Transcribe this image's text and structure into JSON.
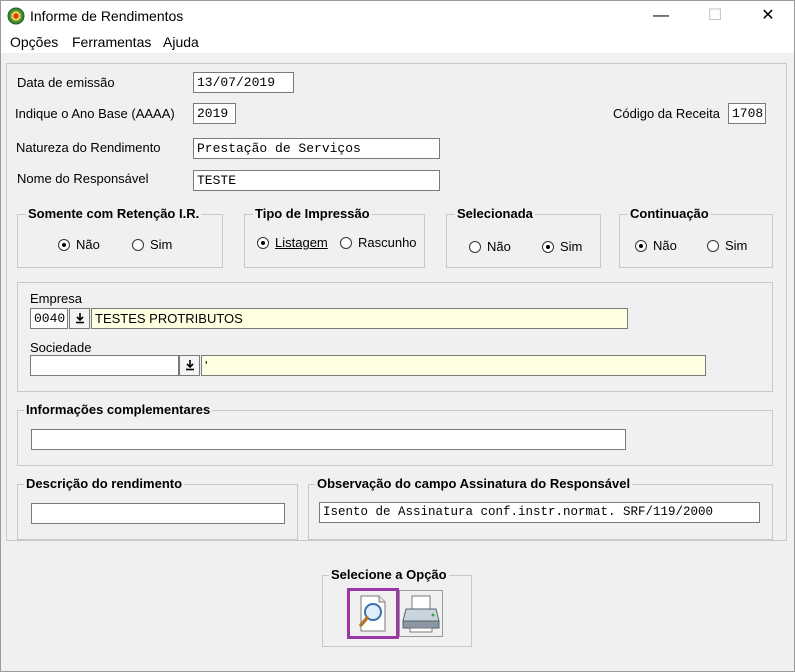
{
  "window": {
    "title": "Informe de Rendimentos",
    "minimize": "—",
    "maximize": "☐",
    "close": "✕"
  },
  "menu": [
    "Opções",
    "Ferramentas",
    "Ajuda"
  ],
  "form": {
    "data_emissao_label": "Data de emissão",
    "data_emissao_value": "13/07/2019",
    "ano_base_label": "Indique o Ano Base (AAAA)",
    "ano_base_value": "2019",
    "codigo_receita_label": "Código da Receita",
    "codigo_receita_value": "1708",
    "natureza_label": "Natureza do Rendimento",
    "natureza_value": "Prestação de Serviços",
    "responsavel_label": "Nome do Responsável",
    "responsavel_value": "TESTE"
  },
  "groups": {
    "retencao": {
      "title": "Somente com Retenção I.R.",
      "opt1": "Não",
      "opt2": "Sim"
    },
    "impressao": {
      "title": "Tipo de Impressão",
      "opt1": "Listagem",
      "opt2": "Rascunho"
    },
    "selecionada": {
      "title": "Selecionada",
      "opt1": "Não",
      "opt2": "Sim"
    },
    "continuacao": {
      "title": "Continuação",
      "opt1": "Não",
      "opt2": "Sim"
    }
  },
  "empresa": {
    "label": "Empresa",
    "code": "0040",
    "name": "TESTES PROTRIBUTOS",
    "sociedade_label": "Sociedade",
    "sociedade_code": "",
    "sociedade_name": "'"
  },
  "info_complementares": {
    "title": "Informações complementares",
    "value": ""
  },
  "descricao": {
    "title": "Descrição do rendimento",
    "value": ""
  },
  "observacao": {
    "title": "Observação do campo Assinatura do Responsável",
    "value": "Isento de Assinatura conf.instr.normat. SRF/119/2000"
  },
  "opcao": {
    "title": "Selecione a Opção"
  },
  "icons": {
    "app": "app-icon",
    "preview": "magnifier-page-icon",
    "print": "printer-icon",
    "dropdown": "download-arrow-icon"
  }
}
